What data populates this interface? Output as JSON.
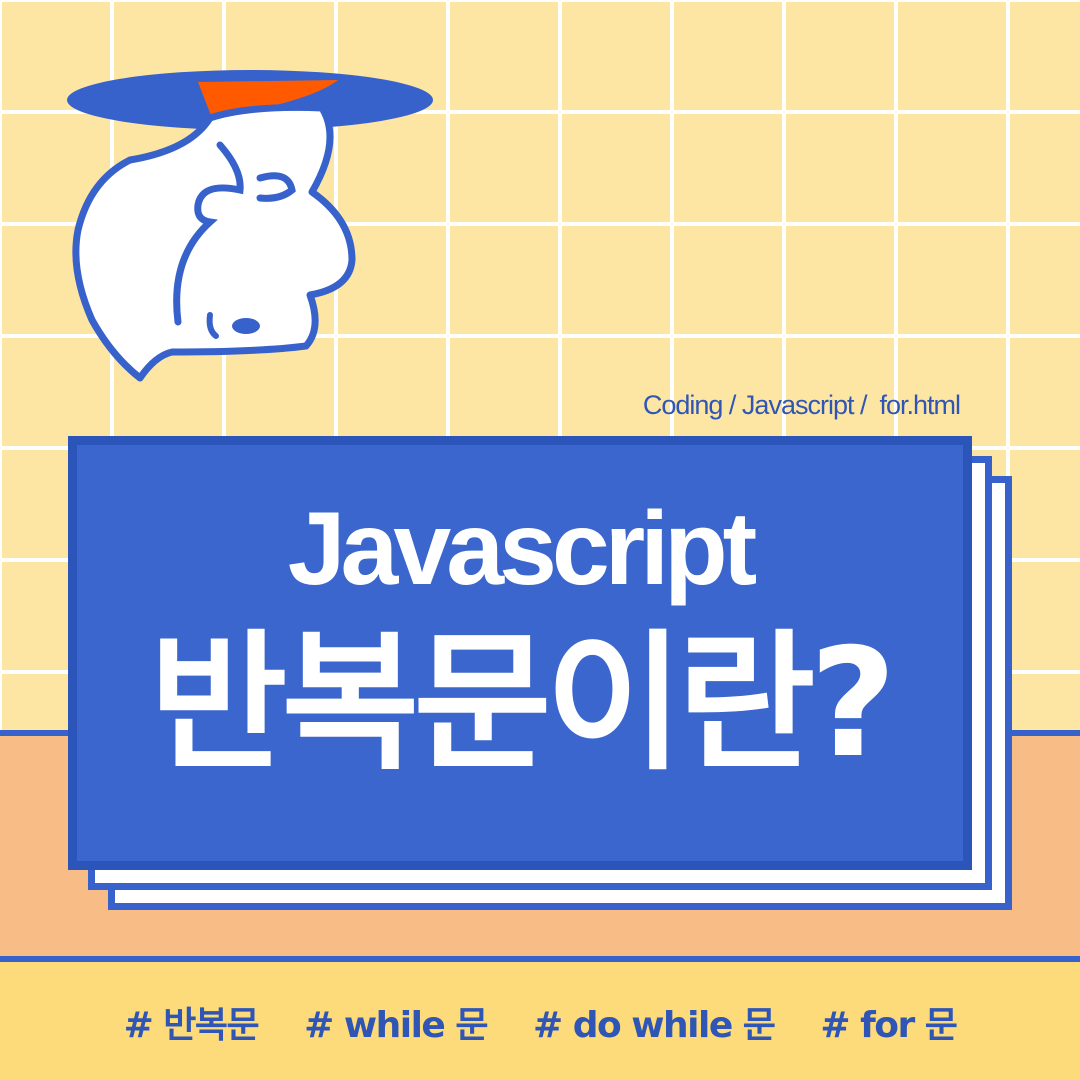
{
  "breadcrumb": "Coding / Javascript /  for.html",
  "title_en": "Javascript",
  "title_ko": "반복문이란?",
  "tags": [
    "# 반복문",
    "# while 문",
    "# do while 문",
    "# for 문"
  ],
  "colors": {
    "grid_bg": "#fde6a3",
    "grid_lines": "#ffffff",
    "floor": "#f8bd87",
    "bottom_strip": "#fddb7b",
    "card_blue": "#3a66ce",
    "outline_blue": "#3762cb",
    "accent_orange": "#ff5a00",
    "text_white": "#ffffff"
  },
  "icons": {
    "mascot": "ghost-character-with-blue-hat-icon"
  }
}
